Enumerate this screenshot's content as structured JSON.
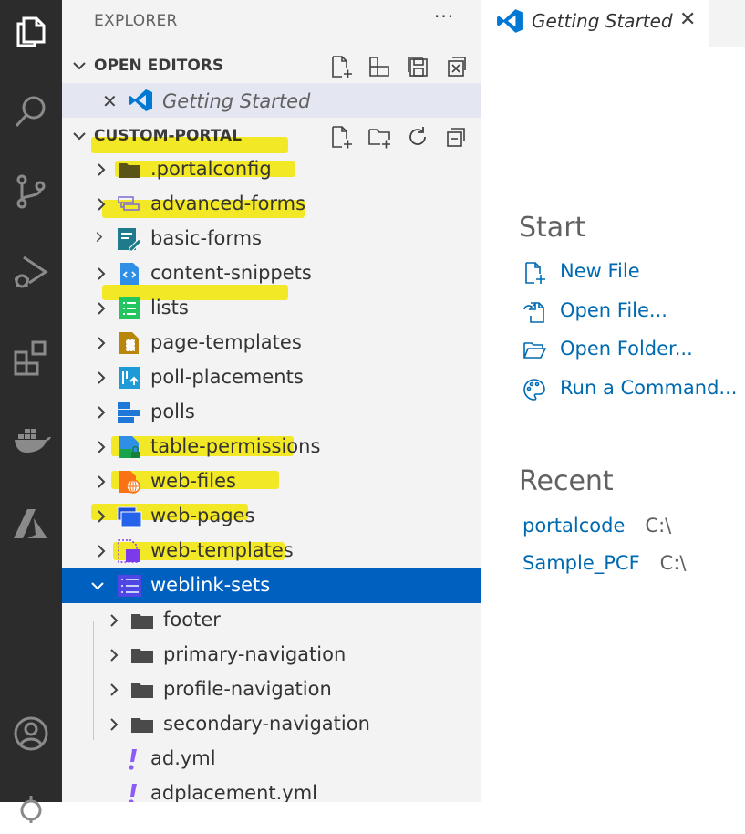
{
  "activity_bar": {
    "items": [
      {
        "icon": "explorer-icon"
      },
      {
        "icon": "search-icon"
      },
      {
        "icon": "source-control-icon"
      },
      {
        "icon": "run-debug-icon"
      },
      {
        "icon": "extensions-icon"
      },
      {
        "icon": "docker-icon"
      },
      {
        "icon": "azure-icon"
      },
      {
        "icon": "accounts-icon"
      },
      {
        "icon": "manage-icon"
      }
    ]
  },
  "sidebar": {
    "title": "EXPLORER",
    "more_label": "···",
    "open_editors": {
      "label": "OPEN EDITORS",
      "items": [
        {
          "name": "Getting Started",
          "close_label": "✕"
        }
      ]
    },
    "folder": {
      "label": "CUSTOM-PORTAL",
      "items": [
        {
          "name": ".portalconfig",
          "icon": "folder-dark-icon"
        },
        {
          "name": "advanced-forms",
          "icon": "advanced-forms-icon"
        },
        {
          "name": "basic-forms",
          "icon": "basic-forms-icon"
        },
        {
          "name": "content-snippets",
          "icon": "content-snippets-icon"
        },
        {
          "name": "lists",
          "icon": "lists-icon"
        },
        {
          "name": "page-templates",
          "icon": "page-templates-icon"
        },
        {
          "name": "poll-placements",
          "icon": "poll-placements-icon"
        },
        {
          "name": "polls",
          "icon": "polls-icon"
        },
        {
          "name": "table-permissions",
          "icon": "table-permissions-icon"
        },
        {
          "name": "web-files",
          "icon": "web-files-icon"
        },
        {
          "name": "web-pages",
          "icon": "web-pages-icon"
        },
        {
          "name": "web-templates",
          "icon": "web-templates-icon"
        },
        {
          "name": "weblink-sets",
          "icon": "weblink-sets-icon",
          "expanded": true,
          "selected": true
        },
        {
          "name": "footer",
          "icon": "folder-icon",
          "depth": 1
        },
        {
          "name": "primary-navigation",
          "icon": "folder-icon",
          "depth": 1
        },
        {
          "name": "profile-navigation",
          "icon": "folder-icon",
          "depth": 1
        },
        {
          "name": "secondary-navigation",
          "icon": "folder-icon",
          "depth": 1
        },
        {
          "name": "ad.yml",
          "icon": "yaml-icon",
          "depth": 1
        },
        {
          "name": "adplacement.yml",
          "icon": "yaml-icon",
          "depth": 1
        }
      ]
    }
  },
  "editor": {
    "tab": {
      "title": "Getting Started",
      "close_label": "✕"
    },
    "start": {
      "heading": "Start",
      "items": [
        {
          "label": "New File",
          "icon": "new-file-icon"
        },
        {
          "label": "Open File...",
          "icon": "open-file-icon"
        },
        {
          "label": "Open Folder...",
          "icon": "open-folder-icon"
        },
        {
          "label": "Run a Command...",
          "icon": "palette-icon"
        }
      ]
    },
    "recent": {
      "heading": "Recent",
      "items": [
        {
          "name": "portalcode",
          "path": "C:\\"
        },
        {
          "name": "Sample_PCF",
          "path": "C:\\"
        }
      ]
    }
  },
  "colors": {
    "activity_bar": "#2c2c2c",
    "sidebar": "#f3f3f3",
    "selection": "#0060c0",
    "link": "#006ab1",
    "highlight": "#fff200"
  }
}
